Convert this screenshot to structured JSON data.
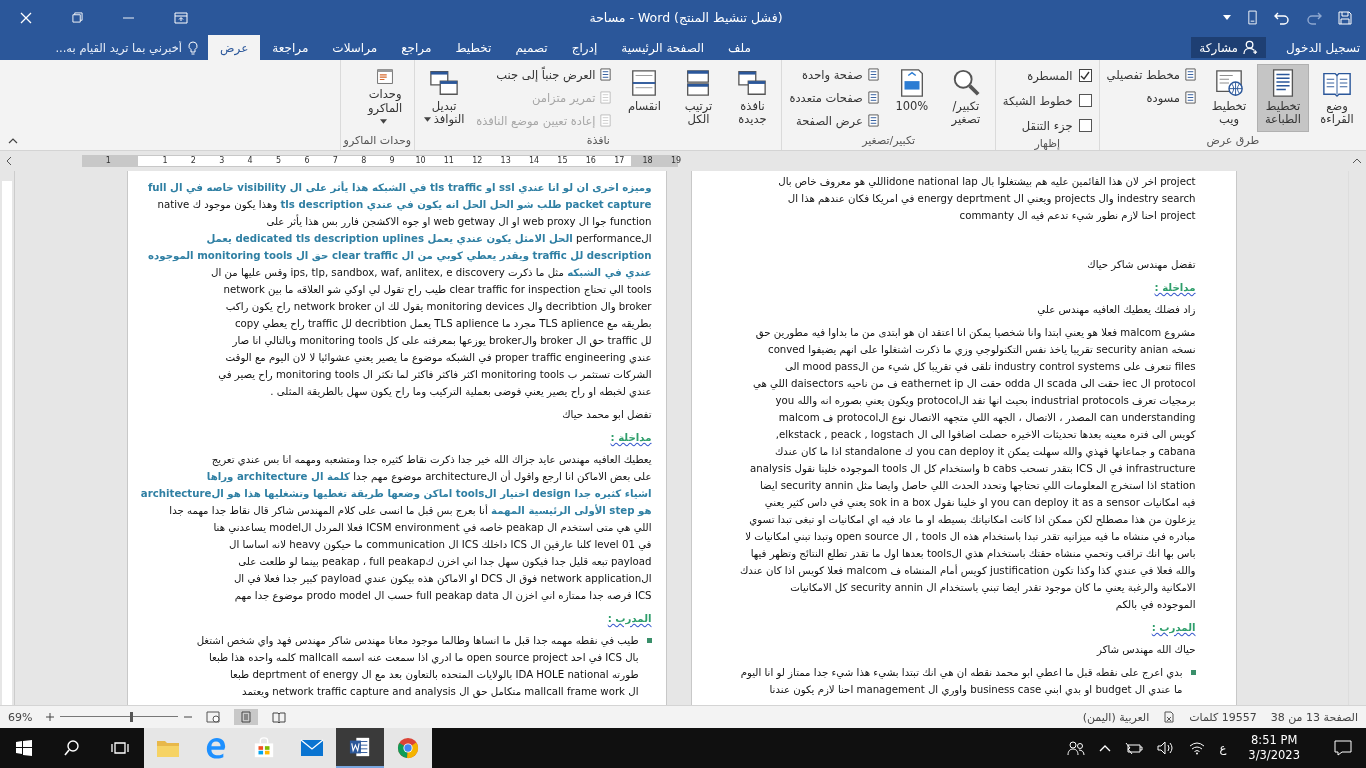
{
  "window": {
    "title": "مساحة - Word (فشل تنشيط المنتج)"
  },
  "tabs": [
    {
      "label": "ملف",
      "selected": false
    },
    {
      "label": "الصفحة الرئيسية",
      "selected": false
    },
    {
      "label": "إدراج",
      "selected": false
    },
    {
      "label": "تصميم",
      "selected": false
    },
    {
      "label": "تخطيط",
      "selected": false
    },
    {
      "label": "مراجع",
      "selected": false
    },
    {
      "label": "مراسلات",
      "selected": false
    },
    {
      "label": "مراجعة",
      "selected": false
    },
    {
      "label": "عرض",
      "selected": true
    }
  ],
  "tell_me": {
    "placeholder": "أخبرني بما تريد القيام به..."
  },
  "sign_in": "تسجيل الدخول",
  "share": "مشاركة",
  "ribbon": [
    {
      "label": "طرق عرض",
      "columns": [
        [
          {
            "kind": "large",
            "label": "وضع القراءة",
            "selected": false
          }
        ],
        [
          {
            "kind": "large",
            "label": "تخطيط الطباعة",
            "selected": true
          }
        ],
        [
          {
            "kind": "large",
            "label": "تخطيط ويب",
            "selected": false
          }
        ],
        [
          {
            "kind": "small",
            "label": "مخطط تفصيلي",
            "disabled": false
          },
          {
            "kind": "small",
            "label": "مسودة",
            "disabled": false
          }
        ]
      ]
    },
    {
      "label": "إظهار",
      "columns": [
        [
          {
            "kind": "check",
            "label": "المسطرة",
            "checked": true
          },
          {
            "kind": "check",
            "label": "خطوط الشبكة",
            "checked": false
          },
          {
            "kind": "check",
            "label": "جزء التنقل",
            "checked": false
          }
        ]
      ]
    },
    {
      "label": "تكبير/تصغير",
      "columns": [
        [
          {
            "kind": "large",
            "label": "تكبير/ تصغير",
            "selected": false
          }
        ],
        [
          {
            "kind": "large",
            "label": "100%",
            "selected": false
          }
        ],
        [
          {
            "kind": "small",
            "label": "صفحة واحدة",
            "disabled": false
          },
          {
            "kind": "small",
            "label": "صفحات متعددة",
            "disabled": false
          },
          {
            "kind": "small",
            "label": "عرض الصفحة",
            "disabled": false
          }
        ]
      ]
    },
    {
      "label": "نافذة",
      "columns": [
        [
          {
            "kind": "large",
            "label": "نافذة جديدة",
            "selected": false
          }
        ],
        [
          {
            "kind": "large",
            "label": "ترتيب الكل",
            "selected": false
          }
        ],
        [
          {
            "kind": "large",
            "label": "انقسام",
            "selected": false
          }
        ],
        [
          {
            "kind": "small",
            "label": "العرض جنباً إلى جنب",
            "disabled": false
          },
          {
            "kind": "small",
            "label": "تمرير متزامن",
            "disabled": true
          },
          {
            "kind": "small",
            "label": "إعادة تعيين موضع النافذة",
            "disabled": true
          }
        ],
        [
          {
            "kind": "large",
            "label": "تبديل النوافذ",
            "selected": false,
            "menu": true
          }
        ]
      ]
    },
    {
      "label": "وحدات الماكرو",
      "columns": [
        [
          {
            "kind": "large",
            "label": "وحدات الماكرو",
            "selected": false,
            "menu": true
          }
        ]
      ]
    }
  ],
  "ruler": [
    "19",
    "18",
    "17",
    "16",
    "15",
    "14",
    "13",
    "12",
    "11",
    "10",
    "9",
    "8",
    "7",
    "6",
    "5",
    "4",
    "3",
    "2",
    "1",
    "1"
  ],
  "pages": [
    {
      "blocks": [
        {
          "kind": "text",
          "lines": [
            "project اخر لان هذا القائمين عليه هم بيشتغلوا بال idone national lapاللي هو معروف خاص بال",
            "indestry search وال projects ويعني ال energy deprtment في امريكا فكان عندهم هذا ال",
            "project احنا لازم نطور شيء تدعم فيه ال commanty"
          ]
        },
        {
          "kind": "speaker",
          "text": "تفضل مهندس شاكر حياك"
        },
        {
          "kind": "heading",
          "text": "مداخلة :"
        },
        {
          "kind": "speaker",
          "text": "زاد فضلك يعطيك العافيه مهندس علي"
        },
        {
          "kind": "text",
          "lines": [
            "مشروع malcom فعلا هو يعني ابتدا وانا شخصيا يمكن انا اعتقد ان هو ابتدى من ما بداوا فيه مطورين حق",
            "نسخه security anian  تقريبا ياخذ نفس التكنولوجي وزي ما ذكرت اشتغلوا على انهم يضيفوا  conved",
            "files تتعرف على  industry control systems  تلقى في تقريبا كل شيء من الmood pass  الى",
            "protocol ال iec حقت الى scada ال odda حقت ال eathernet ip ف من ناحيه daisectors اللي هي",
            "برمجيات تعرف industrial protocols بحيث انها تفد الprotocol ويكون يعني بصوره انه والله  you",
            "can understanding المصدر ، الاتصال ، الجهه اللي متجهه الاتصال نوع الprotocol ف malcom",
            "كويس الى فتره معينه بعدها تحديثات الاخيره حصلت اضافوا الى ال  elkstack , peack , logstach,",
            "cabana  و جماعاتها فهذي والله سهلت يمكن you can deploy it ك standalone اذا ما كان عندك",
            "infrastructure في ال ICS بتقدر تسحب b cabs واستخدام كل ال tools الموجوده خلينا نقول  analysis",
            "station اذا استخرج المعلومات اللي تحتاجها وتحدد الحدث اللي حاصل وايضا مثل  security annin ايضا",
            "فيه امكانيات you can deploy it as a sensor او خلينا نقول sok in a box يعني في داس كثير يعني",
            "يزعلون من هذا مصطلح لكن ممكن اذا كانت امكانياتك بسيطه او ما عاد فيه اي امكانيات او تبغى تبدا تسوي",
            "مبادره في منشاه ما فيه ميزانيه تقدر تبدا باستخدام هذه ال tools , ال open source  وتبدا تبني امكانيات لا",
            "باس بها انك تراقب وتحمي منشاه حقتك باستخدام هذي الtools بعدها اول ما تقدر تطلع النتائج وتظهر فيها",
            "والله فعلا في عندي كذا وكذا تكون justification كويس أمام المنشاه ف malcom فعلا كويس اذا كان عندك",
            "الامكانية والرغبة يعني ما كان موجود تقدر ايضا تبني باستخدام ال security annin  كل الامكانيات",
            "الموجوده في بالكم"
          ]
        },
        {
          "kind": "heading",
          "text": "المدرب :"
        },
        {
          "kind": "speaker",
          "text": "حياك الله مهندس شاكر"
        },
        {
          "kind": "bullet",
          "lines": [
            "بدي اعرج على نقطه قبل ما اعطي ابو محمد نقطه ان هي انك تبتدا بشيء هذا  شيء جدا ممتاز لو انا اليوم",
            "ما عندي ال budget او بدي ابني business case واوري ال management احنا لازم يكون عندنا"
          ]
        }
      ]
    },
    {
      "blocks": [
        {
          "kind": "text",
          "lines": [
            [
              {
                "text": "وميزه اخرى ان لو انا عندي ssl او tls traffic  في الشبكه هذا يأثر على ال visibility خاصه في ال full",
                "accent": true
              }
            ],
            [
              {
                "text": "packet capture طلب شو الحل الحل انه يكون في عندي tls description",
                "accent": true
              },
              {
                "text": " وهذا يكون موجود ك native",
                "accent": false
              }
            ],
            "function جوا ال web proxy او ال web getway او جوه الاكشجن فارر بس هذا يأثر على",
            [
              {
                "text": "الperformance ",
                "accent": false
              },
              {
                "text": " الحل الامثل يكون عندي يعمل dedicated tls description uplines  يعمل",
                "accent": true
              }
            ],
            [
              {
                "text": "description لل traffic ويقدر يعطي كوبي من ال clear traffic حق ال monitoring tools الموجوده",
                "accent": true
              }
            ],
            [
              {
                "text": "عندي في الشبكه",
                "accent": true
              },
              {
                "text": " مثل ما ذكرت  ips, tlp, sandbox, waf, anlitex, e discovery  وقس عليها من ال",
                "accent": false
              }
            ],
            "tools الي  تحتاج  clear traffic for inspection  طيب راح تقول لي اوكي شو العلاقه ما بين  network",
            "broker وال decribtion وال monitoring devices يقول لك ان network broker راح يكون راكب",
            "بطريقه مع TLS aplience  مجرد ما TLS aplience  يعمل decribtion لل traffic  راح يعطي  copy",
            "لل  traffic  حق ال broker والbroker  يوزعها بمعرفته على كل monitoring tools وبالتالي انا صار",
            "عندي proper traffic engineering في الشبكه موضوع ما يصير يعني عشوائيا لا لان اليوم مع الوقت",
            "الشركات تستثمر ب monitoring tools اكثر فاكثر فاكثر لما تكثر ال monitoring tools راح يصير في",
            "عندي لخبطه او راح يصير يعني فوضى بعملية التركيب وما راح يكون سهل بالطريقة المثلى ."
          ]
        },
        {
          "kind": "speaker",
          "text": "تفضل ابو محمد حياك"
        },
        {
          "kind": "heading",
          "text": "مداخلة :"
        },
        {
          "kind": "text",
          "lines": [
            "يعطيك العافيه مهندس عايد جزاك الله خير جدا ذكرت نقاط كثيره جدا ومتشعبه ومهمه انا بس عندي تعريج",
            [
              {
                "text": "على بعض الاماكن انا ارجع واقول أن الarchitecture  موضوع مهم جدا ",
                "accent": false
              },
              {
                "text": "كلمة ال architecture وراها",
                "accent": true
              }
            ],
            [
              {
                "text": "اشياء كثيره جدا  design  اختيار الtools اماكن وضعها طريقة تغطيها وتشغليها هذا هو الarchitecture",
                "accent": true
              }
            ],
            [
              {
                "text": "هو step الأولى الرئيسية المهمة",
                "accent": true
              },
              {
                "text": " أنا بعرج بس قبل ما انسى على كلام المهندس شاكر قال نقاط جدا مهمه جدا",
                "accent": false
              }
            ],
            "اللي هي متى استخدم ال peakap خاصه في  ICSM environment فعلا المردل الmodel يساعدني هنا",
            "في level 01 كلنا عارفين ال ICS داخلك ICS ال  communication ما حيكون heavy لانه اساسا ال",
            "payload تبعه قليل جدا فيكون سهل جدا اني اخزن كpeakap  ،  full peakap بينما لو طلعت على",
            "الnetwork  application فوق ال DCS او الاماكن هذه بيكون عندي payload  كبير جدا فعلا في ال",
            "ICS  فرصه جدا ممتازه اني اخزن ال full peakap data  حسب ال prodo model موضوع جدا مهم"
          ]
        },
        {
          "kind": "heading",
          "text": "المدرب :"
        },
        {
          "kind": "bullet",
          "lines": [
            "طيب في نقطه مهمه جدا قبل ما انساها وطالما موجود معانا مهندس شاكر مهندس فهد واي شخص اشتغل",
            "بال ICS في احد  open source project ما ادري اذا سمعت عنه اسمه mallcall كلمه واحده هذا طبعا",
            "طورته  IDA HOLE national  بالولايات المتحده  بالتعاون بعد مع ال deprtment of energy  طبعا",
            "ال mallcall  frame work متكامل حق ال network traffic capture and  analysis ويعتمد"
          ]
        }
      ]
    }
  ],
  "status_bar": {
    "page": "الصفحة 13 من 38",
    "words": "19557 كلمات",
    "language": "العربية (اليمن)",
    "zoom": "69%",
    "zoom_slider": {
      "level": 0.6
    }
  },
  "taskbar": {
    "input_language": "ع",
    "time": "8:51 PM",
    "date": "3/3/2023"
  }
}
